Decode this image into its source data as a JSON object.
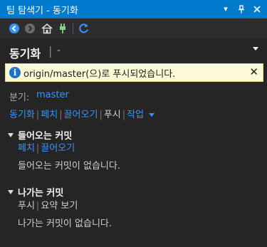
{
  "window": {
    "title": "팀 탐색기 - 동기화",
    "pin_glyph": "▾",
    "dock_glyph": "❘",
    "close_glyph": "✕"
  },
  "toolbar": {
    "icons": [
      "back-icon",
      "forward-icon",
      "home-icon",
      "connect-icon",
      "refresh-icon"
    ]
  },
  "header": {
    "title": "동기화",
    "separator": "|",
    "subtitle": "-"
  },
  "info_bar": {
    "icon": "i",
    "message": "origin/master(으)로 푸시되었습니다.",
    "close": "✕"
  },
  "branch": {
    "label": "분기:",
    "value": "master"
  },
  "nav": {
    "sync": "동기화",
    "fetch": "페치",
    "pull": "끌어오기",
    "push": "푸시",
    "actions": "작업"
  },
  "incoming": {
    "title": "들어오는 커밋",
    "fetch": "페치",
    "pull": "끌어오기",
    "empty": "들어오는 커밋이 없습니다."
  },
  "outgoing": {
    "title": "나가는 커밋",
    "push": "푸시",
    "summary": "요약 보기",
    "empty": "나가는 커밋이 없습니다."
  },
  "colors": {
    "accent": "#007acc",
    "link": "#3794ff",
    "background": "#252526",
    "info_bg": "#fcf9d7"
  }
}
